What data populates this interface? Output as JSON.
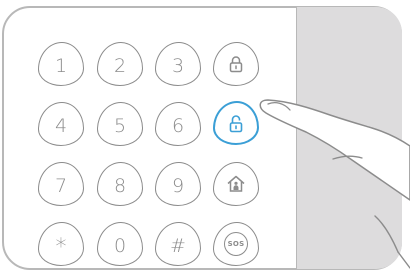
{
  "keypad": {
    "keys": [
      {
        "label": "1",
        "type": "digit"
      },
      {
        "label": "2",
        "type": "digit"
      },
      {
        "label": "3",
        "type": "digit"
      },
      {
        "icon": "lock-closed-icon",
        "type": "icon"
      },
      {
        "label": "4",
        "type": "digit"
      },
      {
        "label": "5",
        "type": "digit"
      },
      {
        "label": "6",
        "type": "digit"
      },
      {
        "icon": "lock-open-icon",
        "type": "icon",
        "active": true
      },
      {
        "label": "7",
        "type": "digit"
      },
      {
        "label": "8",
        "type": "digit"
      },
      {
        "label": "9",
        "type": "digit"
      },
      {
        "icon": "home-person-icon",
        "type": "icon"
      },
      {
        "label": "*",
        "type": "digit"
      },
      {
        "label": "0",
        "type": "digit"
      },
      {
        "label": "#",
        "type": "digit"
      },
      {
        "label": "SOS",
        "type": "sos"
      }
    ]
  },
  "colors": {
    "outline": "#8c8c8c",
    "active": "#3b9fd6",
    "panel": "#dddcdd"
  }
}
